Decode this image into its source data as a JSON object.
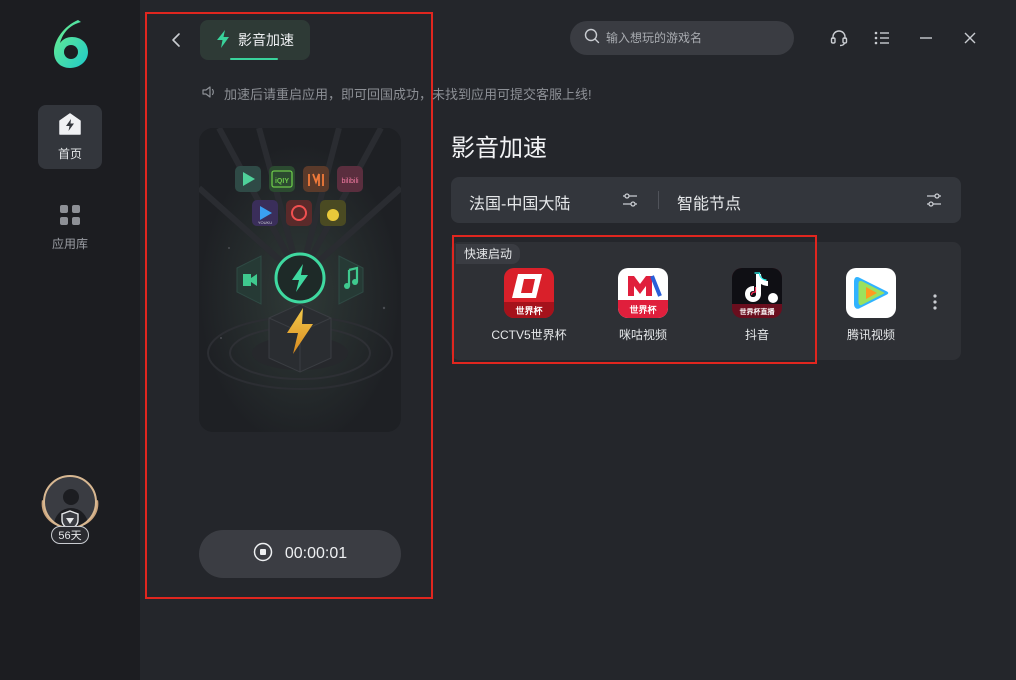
{
  "sidebar": {
    "items": [
      {
        "label": "首页",
        "icon": "home-bolt-icon",
        "active": true
      },
      {
        "label": "应用库",
        "icon": "grid-apps-icon",
        "active": false
      }
    ],
    "user": {
      "days_badge": "56天"
    }
  },
  "header": {
    "tag_label": "影音加速",
    "notice": "加速后请重启应用，即可回国成功，未找到应用可提交客服上线!",
    "search": {
      "placeholder": "输入想玩的游戏名",
      "value": ""
    },
    "icons": [
      "support-headset-icon",
      "list-menu-icon",
      "minimize-icon",
      "close-icon"
    ]
  },
  "timer": {
    "value": "00:00:01"
  },
  "main": {
    "title": "影音加速",
    "node": {
      "region": "法国-中国大陆",
      "mode": "智能节点"
    },
    "quick_launch": {
      "label": "快速启动",
      "apps": [
        {
          "name": "CCTV5世界杯",
          "icon": "cctv5-worldcup-icon"
        },
        {
          "name": "咪咕视频",
          "icon": "migu-video-icon"
        },
        {
          "name": "抖音",
          "icon": "douyin-icon"
        },
        {
          "name": "腾讯视频",
          "icon": "tencent-video-icon"
        }
      ]
    }
  },
  "phone_art": {
    "app_icons": [
      "video-play-icon",
      "iqiyi-icon",
      "mango-tv-icon",
      "bilibili-icon",
      "youku-icon",
      "netease-music-icon",
      "qq-music-icon"
    ],
    "icon_text": {
      "iqiyi": "iQIY",
      "bilibili": "bilibili",
      "youku": "YOUKU",
      "cctv": "世界杯",
      "migu": "世界杯",
      "douyin": "世界杯直播"
    }
  },
  "colors": {
    "accent": "#39d39b",
    "highlight_border": "#e0261f",
    "background": "#24262b",
    "sidebar": "#1c1d21"
  }
}
